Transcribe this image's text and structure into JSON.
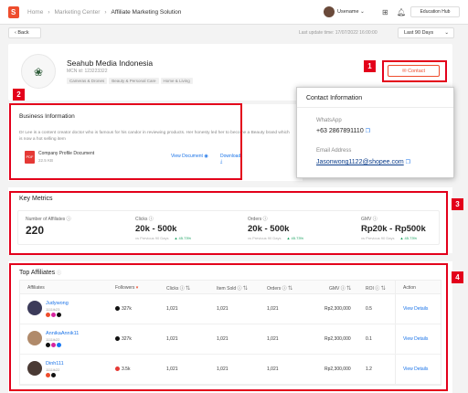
{
  "header": {
    "logo_letter": "S",
    "breadcrumb": [
      "Home",
      "Marketing Center",
      "Affiliate Marketing Solution"
    ],
    "username": "Usename",
    "education_hub": "Education Hub"
  },
  "subbar": {
    "back_label": "Back",
    "last_update": "Last update time: 17/07/2022 16:00:00",
    "period_label": "Last 90 Days"
  },
  "profile": {
    "name": "Seahub Media Indonesia",
    "mcn_id": "MCN id: 123223322",
    "tags": [
      "Cameras & Drones",
      "Beauty & Personal Care",
      "Home & Living"
    ],
    "contact_label": "Contact"
  },
  "contact_popup": {
    "title": "Contact Information",
    "whatsapp_label": "WhatsApp",
    "whatsapp_value": "+63 2867891110",
    "email_label": "Email Address",
    "email_value": "Jasonwong1122@shopee.com"
  },
  "business": {
    "title": "Business Information",
    "description": "Dr Lee is a content creator doctor who is famous for his candor in reviewing products. Her honesty led her to become a Beauty brand which is now a hot selling item",
    "doc_name": "Company Profile Document",
    "doc_size": "22.5 KB",
    "view_label": "View Document",
    "download_label": "Download"
  },
  "key_metrics": {
    "title": "Key Metrics",
    "items": [
      {
        "label": "Number of Affiliates",
        "value": "220",
        "prev": "",
        "change": ""
      },
      {
        "label": "Clicks",
        "value": "20k - 500k",
        "prev": "vs Previous 90 Days",
        "change": "▲ 45.73%"
      },
      {
        "label": "Orders",
        "value": "20k - 500k",
        "prev": "vs Previous 90 Days",
        "change": "▲ 45.73%"
      },
      {
        "label": "GMV",
        "value": "Rp20k - Rp500k",
        "prev": "vs Previous 90 Days",
        "change": "▲ 45.73%"
      }
    ]
  },
  "top_affiliates": {
    "title": "Top Affiliates",
    "columns": [
      "Affiliates",
      "Followers",
      "Clicks",
      "Item Sold",
      "Orders",
      "GMV",
      "ROI",
      "Action"
    ],
    "rows": [
      {
        "name": "Judywong",
        "id": "1111ik23",
        "followers": "327k",
        "clicks": "1,021",
        "items": "1,021",
        "orders": "1,021",
        "gmv": "Rp2,300,000",
        "roi": "0.5",
        "action": "View Details",
        "avatar": "#3c3b5a"
      },
      {
        "name": "AnnikaAnnik11",
        "id": "1111ik22",
        "followers": "327k",
        "clicks": "1,021",
        "items": "1,021",
        "orders": "1,021",
        "gmv": "Rp2,300,000",
        "roi": "0.1",
        "action": "View Details",
        "avatar": "#b08a6a"
      },
      {
        "name": "Dinh111",
        "id": "1111ik22",
        "followers": "3.5k",
        "clicks": "1,021",
        "items": "1,021",
        "orders": "1,021",
        "gmv": "Rp2,300,000",
        "roi": "1.2",
        "action": "View Details",
        "avatar": "#4a3a34"
      }
    ]
  },
  "callouts": [
    "1",
    "2",
    "3",
    "4"
  ],
  "colors": {
    "brand": "#ee4d2d",
    "callout": "#e3001b",
    "link": "#1a73e8",
    "positive": "#1aa260"
  }
}
